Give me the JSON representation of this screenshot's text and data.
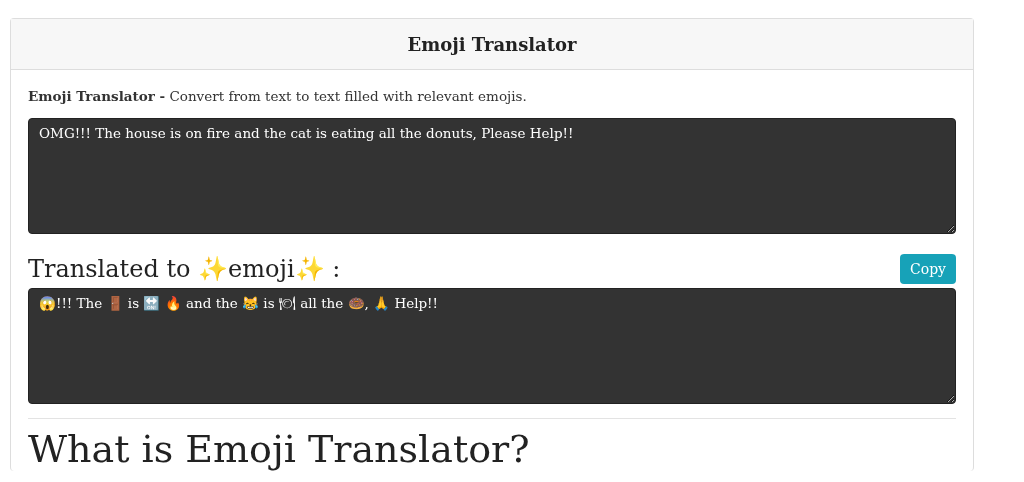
{
  "card": {
    "title": "Emoji Translator"
  },
  "intro": {
    "text": "**Emoji Translator -** Convert from text to text filled with relevant emojis."
  },
  "input": {
    "value": "OMG!!! The house is on fire and the cat is eating all the donuts, Please Help!!"
  },
  "result": {
    "heading": "Translated to ✨emoji✨ :",
    "copy_button": "Copy",
    "value": "😱!!! The 🚪 is 🔛 🔥 and the 😹 is 🍽 all the 🍩, 🙏 Help!!"
  },
  "section": {
    "heading": "What is Emoji Translator?"
  }
}
